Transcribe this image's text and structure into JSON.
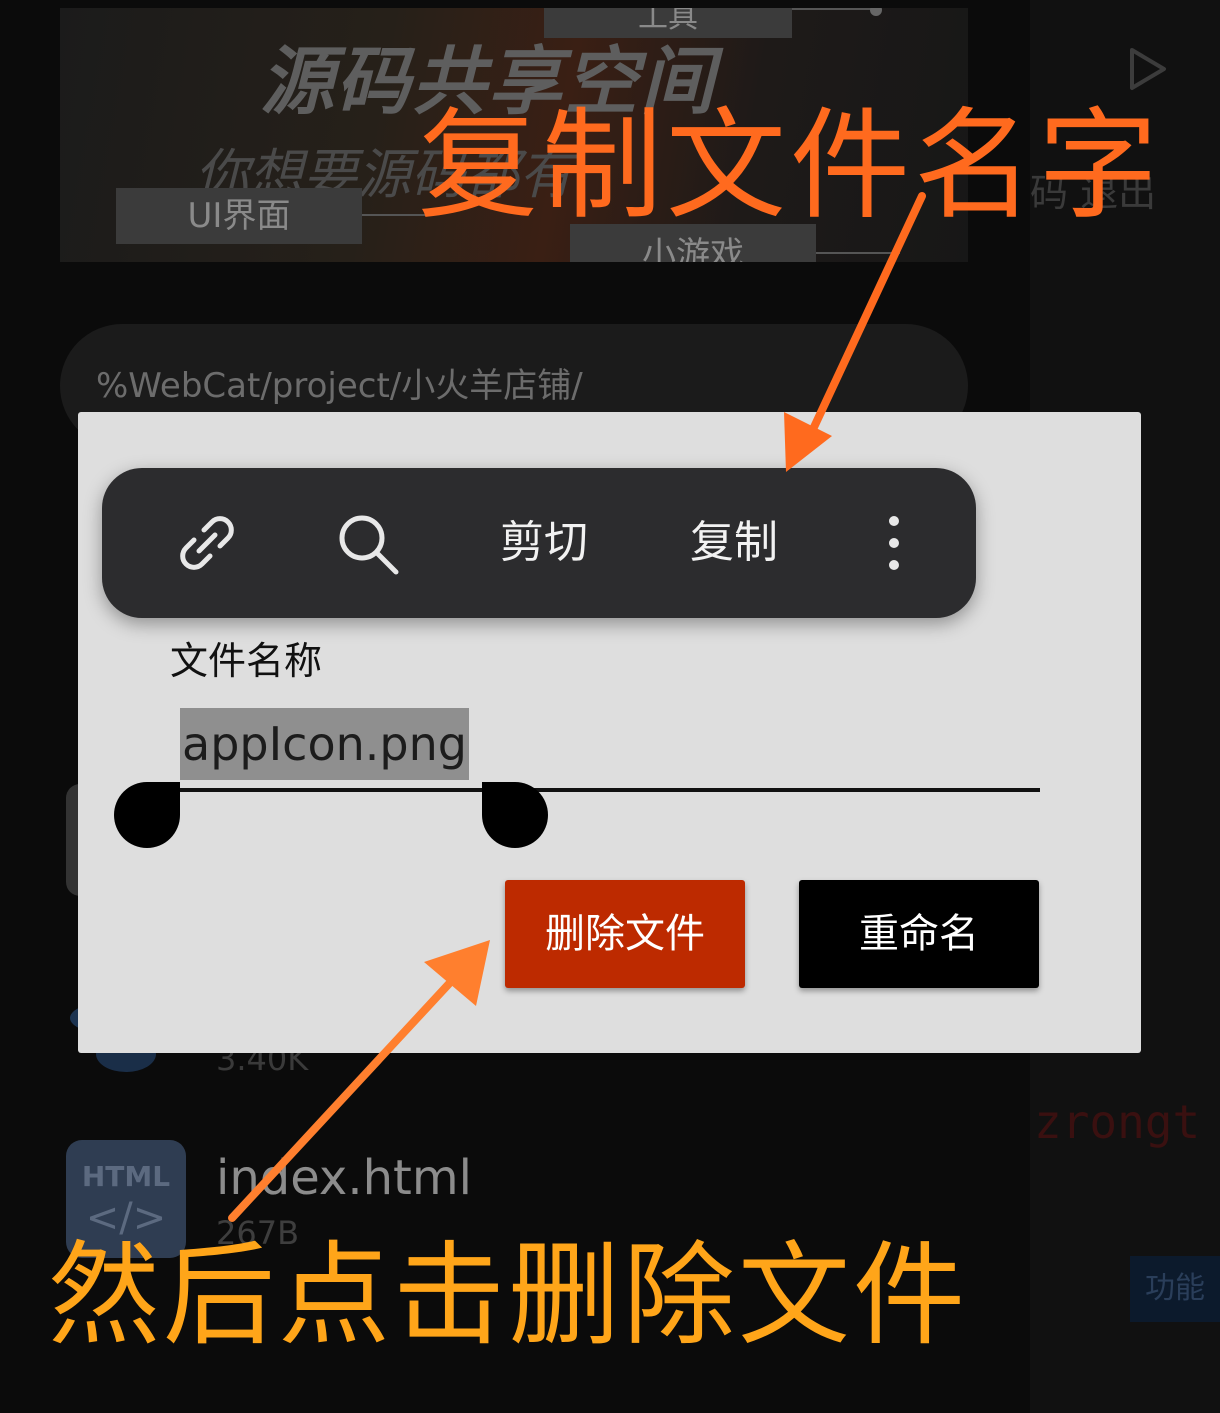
{
  "background": {
    "banner": {
      "title": "源码共享空间",
      "subtitle": "你想要源码都有",
      "tags": {
        "ui": "UI界面",
        "tools": "工具",
        "games": "小游戏"
      }
    },
    "side": {
      "text": "码 退出",
      "code": "zrongt",
      "button": "功能"
    },
    "path": "%WebCat/project/小火羊店铺/",
    "files": [
      {
        "name": "",
        "size": "3.40K"
      },
      {
        "name": "index.html",
        "size": "267B",
        "icon_label": "HTML",
        "icon_glyph": "</>"
      }
    ]
  },
  "dialog": {
    "field_label": "文件名称",
    "field_value": "appIcon.png",
    "delete_button": "删除文件",
    "rename_button": "重命名"
  },
  "selection_toolbar": {
    "icons": [
      "link-icon",
      "search-icon",
      "more-vertical-icon"
    ],
    "cut": "剪切",
    "copy": "复制"
  },
  "annotations": {
    "top": "复制文件名字",
    "bottom": "然后点击删除文件",
    "top_color": "#ff6a1e",
    "bottom_color": "#ffa519"
  },
  "colors": {
    "delete_button": "#bd2a00",
    "rename_button": "#000000",
    "dialog_background": "#dedede",
    "toolbar_background": "#2c2c2e"
  }
}
